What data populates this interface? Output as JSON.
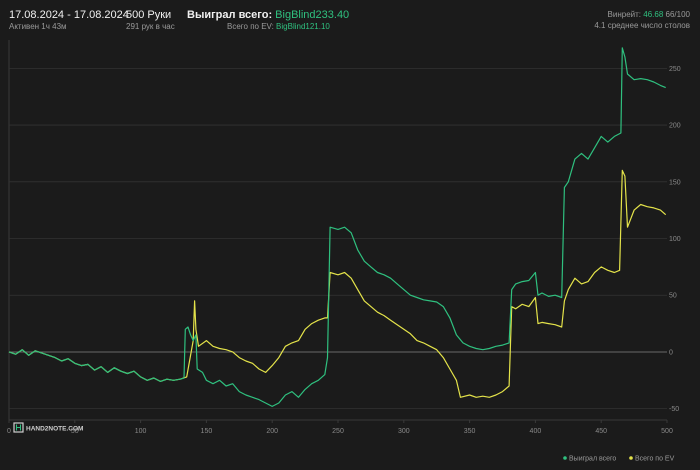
{
  "header": {
    "date_range": "17.08.2024 - 17.08.2024",
    "active_time": "Активен 1ч 43м",
    "hands": "500 Руки",
    "hands_per_hour": "291 рук в час",
    "won_label": "Выиграл всего:",
    "won_value": "BigBlind233.40",
    "ev_label": "Всего по EV:",
    "ev_value": "BigBlind121.10",
    "vpip_label": "Винрейт:",
    "vpip_value": "46.68",
    "vpip_frac": "66/100",
    "avg_tables": "4.1 среднее число столов"
  },
  "logo_text": "HAND2NOTE.COM",
  "colors": {
    "won": "#2fc07f",
    "ev": "#e4e34a",
    "background": "#1b1b1b",
    "grid": "#3a3a3a"
  },
  "chart_data": {
    "type": "line",
    "xlim": [
      0,
      500
    ],
    "ylim": [
      -60,
      275
    ],
    "x_ticks": [
      0,
      50,
      100,
      150,
      200,
      250,
      300,
      350,
      400,
      450,
      500
    ],
    "y_ticks": [
      -50,
      0,
      50,
      100,
      150,
      200,
      250
    ],
    "grid": true,
    "legend_position": "bottom-right",
    "series": [
      {
        "name": "Выиграл всего",
        "color": "#2fc07f",
        "points": [
          [
            0,
            0
          ],
          [
            5,
            -2
          ],
          [
            10,
            2
          ],
          [
            15,
            -3
          ],
          [
            20,
            1
          ],
          [
            25,
            -1
          ],
          [
            30,
            -3
          ],
          [
            35,
            -5
          ],
          [
            40,
            -8
          ],
          [
            45,
            -6
          ],
          [
            50,
            -10
          ],
          [
            55,
            -12
          ],
          [
            60,
            -11
          ],
          [
            65,
            -16
          ],
          [
            70,
            -13
          ],
          [
            75,
            -18
          ],
          [
            80,
            -14
          ],
          [
            85,
            -17
          ],
          [
            90,
            -19
          ],
          [
            95,
            -17
          ],
          [
            100,
            -22
          ],
          [
            105,
            -25
          ],
          [
            110,
            -23
          ],
          [
            115,
            -26
          ],
          [
            120,
            -24
          ],
          [
            125,
            -25
          ],
          [
            130,
            -24
          ],
          [
            133,
            -23
          ],
          [
            134,
            20
          ],
          [
            136,
            22
          ],
          [
            138,
            15
          ],
          [
            140,
            10
          ],
          [
            142,
            15
          ],
          [
            143,
            -15
          ],
          [
            147,
            -18
          ],
          [
            150,
            -25
          ],
          [
            155,
            -28
          ],
          [
            160,
            -25
          ],
          [
            165,
            -30
          ],
          [
            170,
            -28
          ],
          [
            175,
            -35
          ],
          [
            180,
            -38
          ],
          [
            185,
            -40
          ],
          [
            190,
            -42
          ],
          [
            195,
            -45
          ],
          [
            200,
            -48
          ],
          [
            205,
            -45
          ],
          [
            210,
            -38
          ],
          [
            215,
            -35
          ],
          [
            220,
            -40
          ],
          [
            225,
            -33
          ],
          [
            230,
            -28
          ],
          [
            235,
            -25
          ],
          [
            240,
            -20
          ],
          [
            242,
            -5
          ],
          [
            244,
            110
          ],
          [
            250,
            108
          ],
          [
            255,
            110
          ],
          [
            260,
            105
          ],
          [
            265,
            90
          ],
          [
            270,
            80
          ],
          [
            275,
            75
          ],
          [
            280,
            70
          ],
          [
            285,
            68
          ],
          [
            290,
            65
          ],
          [
            295,
            60
          ],
          [
            300,
            55
          ],
          [
            305,
            50
          ],
          [
            310,
            48
          ],
          [
            315,
            46
          ],
          [
            320,
            45
          ],
          [
            325,
            44
          ],
          [
            330,
            40
          ],
          [
            335,
            30
          ],
          [
            340,
            15
          ],
          [
            345,
            8
          ],
          [
            350,
            5
          ],
          [
            355,
            3
          ],
          [
            360,
            2
          ],
          [
            365,
            3
          ],
          [
            370,
            5
          ],
          [
            375,
            6
          ],
          [
            380,
            8
          ],
          [
            382,
            55
          ],
          [
            385,
            60
          ],
          [
            390,
            62
          ],
          [
            395,
            63
          ],
          [
            400,
            70
          ],
          [
            402,
            50
          ],
          [
            405,
            52
          ],
          [
            410,
            49
          ],
          [
            415,
            50
          ],
          [
            420,
            48
          ],
          [
            422,
            145
          ],
          [
            425,
            150
          ],
          [
            430,
            170
          ],
          [
            435,
            175
          ],
          [
            440,
            170
          ],
          [
            445,
            180
          ],
          [
            450,
            190
          ],
          [
            455,
            185
          ],
          [
            460,
            190
          ],
          [
            465,
            193
          ],
          [
            466,
            268
          ],
          [
            468,
            260
          ],
          [
            470,
            245
          ],
          [
            475,
            240
          ],
          [
            480,
            241
          ],
          [
            485,
            240
          ],
          [
            490,
            238
          ],
          [
            495,
            235
          ],
          [
            499,
            233
          ]
        ]
      },
      {
        "name": "Всего по EV",
        "color": "#e4e34a",
        "points": [
          [
            0,
            0
          ],
          [
            5,
            -2
          ],
          [
            10,
            2
          ],
          [
            15,
            -3
          ],
          [
            20,
            1
          ],
          [
            25,
            -1
          ],
          [
            30,
            -3
          ],
          [
            35,
            -5
          ],
          [
            40,
            -8
          ],
          [
            45,
            -6
          ],
          [
            50,
            -10
          ],
          [
            55,
            -12
          ],
          [
            60,
            -11
          ],
          [
            65,
            -16
          ],
          [
            70,
            -13
          ],
          [
            75,
            -18
          ],
          [
            80,
            -14
          ],
          [
            85,
            -17
          ],
          [
            90,
            -19
          ],
          [
            95,
            -17
          ],
          [
            100,
            -22
          ],
          [
            105,
            -25
          ],
          [
            110,
            -23
          ],
          [
            115,
            -26
          ],
          [
            120,
            -24
          ],
          [
            125,
            -25
          ],
          [
            130,
            -24
          ],
          [
            135,
            -22
          ],
          [
            140,
            10
          ],
          [
            141,
            45
          ],
          [
            142,
            20
          ],
          [
            144,
            5
          ],
          [
            150,
            10
          ],
          [
            155,
            5
          ],
          [
            160,
            3
          ],
          [
            165,
            2
          ],
          [
            170,
            0
          ],
          [
            175,
            -5
          ],
          [
            180,
            -8
          ],
          [
            185,
            -10
          ],
          [
            190,
            -15
          ],
          [
            195,
            -18
          ],
          [
            200,
            -12
          ],
          [
            205,
            -5
          ],
          [
            210,
            5
          ],
          [
            215,
            8
          ],
          [
            220,
            10
          ],
          [
            225,
            20
          ],
          [
            230,
            25
          ],
          [
            235,
            28
          ],
          [
            240,
            30
          ],
          [
            242,
            30
          ],
          [
            244,
            70
          ],
          [
            250,
            68
          ],
          [
            255,
            70
          ],
          [
            260,
            65
          ],
          [
            265,
            55
          ],
          [
            270,
            45
          ],
          [
            275,
            40
          ],
          [
            280,
            35
          ],
          [
            285,
            32
          ],
          [
            290,
            28
          ],
          [
            295,
            24
          ],
          [
            300,
            20
          ],
          [
            305,
            16
          ],
          [
            310,
            10
          ],
          [
            315,
            8
          ],
          [
            320,
            5
          ],
          [
            325,
            2
          ],
          [
            330,
            -5
          ],
          [
            335,
            -15
          ],
          [
            340,
            -25
          ],
          [
            343,
            -40
          ],
          [
            350,
            -38
          ],
          [
            355,
            -40
          ],
          [
            360,
            -39
          ],
          [
            365,
            -40
          ],
          [
            370,
            -38
          ],
          [
            375,
            -35
          ],
          [
            380,
            -30
          ],
          [
            382,
            40
          ],
          [
            385,
            38
          ],
          [
            390,
            42
          ],
          [
            395,
            40
          ],
          [
            400,
            48
          ],
          [
            402,
            25
          ],
          [
            405,
            26
          ],
          [
            410,
            25
          ],
          [
            415,
            24
          ],
          [
            420,
            22
          ],
          [
            422,
            45
          ],
          [
            425,
            55
          ],
          [
            430,
            65
          ],
          [
            435,
            60
          ],
          [
            440,
            62
          ],
          [
            445,
            70
          ],
          [
            450,
            75
          ],
          [
            455,
            72
          ],
          [
            460,
            70
          ],
          [
            464,
            72
          ],
          [
            466,
            160
          ],
          [
            468,
            155
          ],
          [
            470,
            110
          ],
          [
            475,
            125
          ],
          [
            480,
            130
          ],
          [
            485,
            128
          ],
          [
            490,
            127
          ],
          [
            495,
            125
          ],
          [
            499,
            121
          ]
        ]
      }
    ]
  }
}
